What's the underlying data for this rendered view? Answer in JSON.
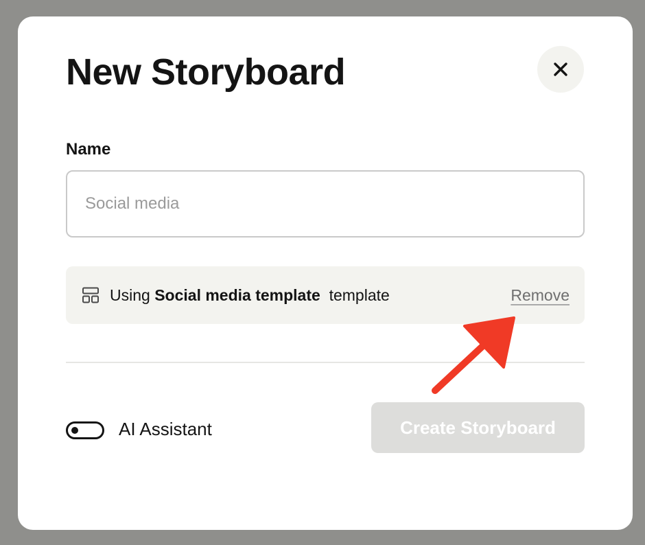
{
  "dialog": {
    "title": "New Storyboard",
    "close_icon": "close-icon"
  },
  "name_field": {
    "label": "Name",
    "placeholder": "Social media",
    "value": ""
  },
  "template_notice": {
    "icon": "layout-template-icon",
    "prefix": "Using ",
    "template_name": "Social media template",
    "suffix": "  template",
    "remove_label": "Remove"
  },
  "footer": {
    "toggle_label": "AI Assistant",
    "toggle_on": false,
    "create_label": "Create Storyboard",
    "create_enabled": false
  },
  "annotation": {
    "color": "#f03a26",
    "icon": "pointer-arrow"
  }
}
